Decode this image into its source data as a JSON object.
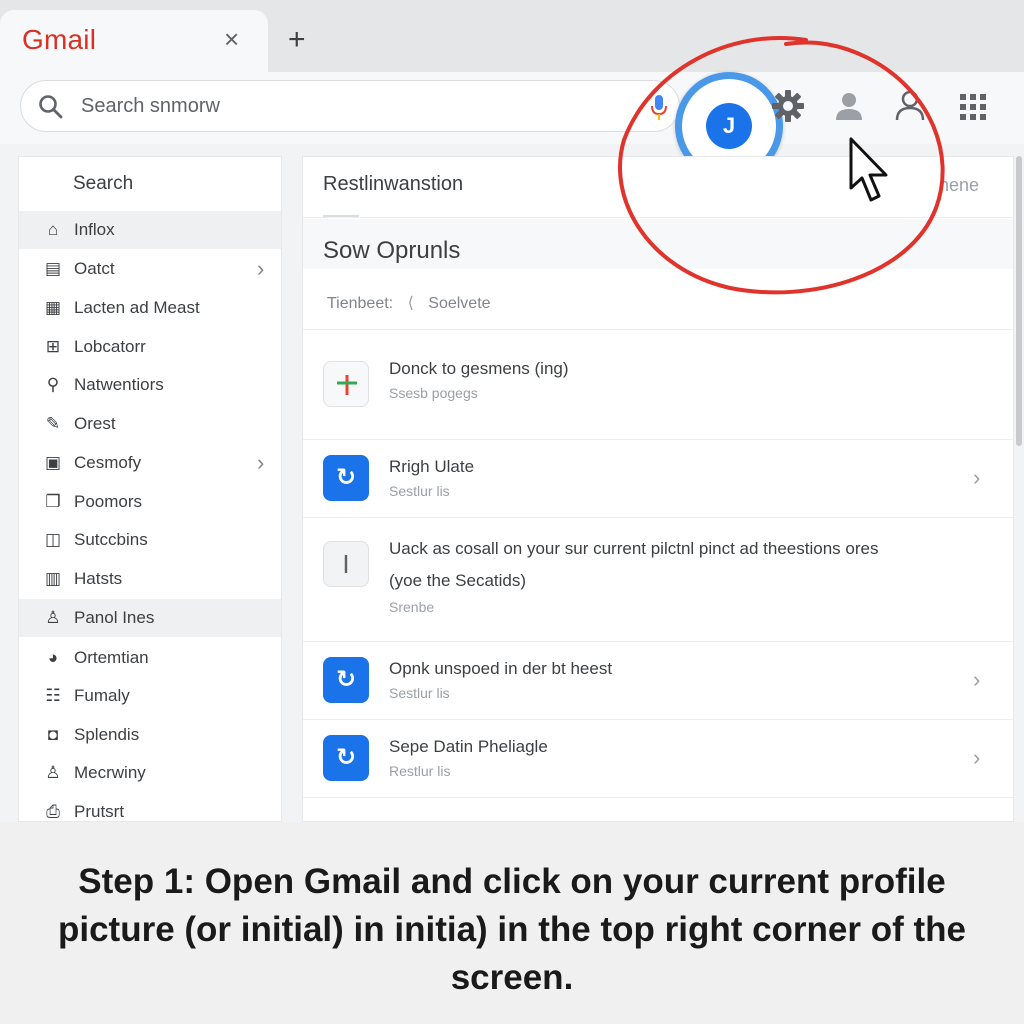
{
  "browser": {
    "tab_title": "Gmail",
    "tab_close": "×",
    "new_tab": "+"
  },
  "header": {
    "search_text": "Search snmorw",
    "avatar_initial": "J",
    "icons": [
      "search-icon",
      "mic-icon",
      "gear-icon",
      "person-icon",
      "person-icon",
      "apps-grid-icon"
    ],
    "accent_ring_color": "#4a98e8",
    "avatar_color": "#1a73e8"
  },
  "sidebar": {
    "heading": "Search",
    "items": [
      {
        "label": "Inflox",
        "icon": "home-icon",
        "chevron": false,
        "active": true
      },
      {
        "label": "Oatct",
        "icon": "contact-card-icon",
        "chevron": true,
        "active": false
      },
      {
        "label": "Lacten ad Meast",
        "icon": "grid-doc-icon",
        "chevron": false,
        "active": false
      },
      {
        "label": "Lobcatorr",
        "icon": "apps-icon",
        "chevron": false,
        "active": false
      },
      {
        "label": "Natwentiors",
        "icon": "location-icon",
        "chevron": false,
        "active": false
      },
      {
        "label": "Orest",
        "icon": "pencil-icon",
        "chevron": false,
        "active": false
      },
      {
        "label": "Cesmofy",
        "icon": "card-icon",
        "chevron": true,
        "active": false
      },
      {
        "label": "Poomors",
        "icon": "copy-icon",
        "chevron": false,
        "active": false
      },
      {
        "label": "Sutccbins",
        "icon": "layers-icon",
        "chevron": false,
        "active": false
      },
      {
        "label": "Hatsts",
        "icon": "calendar-icon",
        "chevron": false,
        "active": false
      },
      {
        "label": "Panol Ines",
        "icon": "person-icon",
        "chevron": false,
        "active": true
      },
      {
        "label": "Ortemtian",
        "icon": "pie-icon",
        "chevron": false,
        "active": false
      },
      {
        "label": "Fumaly",
        "icon": "sliders-icon",
        "chevron": false,
        "active": false
      },
      {
        "label": "Splendis",
        "icon": "chat-icon",
        "chevron": false,
        "active": false
      },
      {
        "label": "Mecrwiny",
        "icon": "person-outline-icon",
        "chevron": false,
        "active": false
      },
      {
        "label": "Prutsrt",
        "icon": "print-icon",
        "chevron": false,
        "active": false
      }
    ]
  },
  "main": {
    "title": "Restlinwanstion",
    "title_right": "nene",
    "section_title": "Sow Oprunls",
    "filter_label": "Tienbeet:",
    "filter_sep": "⟨",
    "filter_value": "Soelvete",
    "items": [
      {
        "title": "Donck to gesmens (ing)",
        "subtitle": "Ssesb pogegs",
        "icon": "plus-color-icon",
        "chevron": false
      },
      {
        "title": "Rrigh Ulate",
        "subtitle": "Sestlur lis",
        "icon": "sync-icon",
        "chevron": true
      },
      {
        "title": "Uack as cosall on your sur current pilctnl pinct ad theestions ores",
        "title2": "(yoe the Secatids)",
        "subtitle": "Srenbe",
        "icon": "text-cursor-icon",
        "chevron": false
      },
      {
        "title": "Opnk unspoed in der bt heest",
        "subtitle": "Sestlur lis",
        "icon": "sync-icon",
        "chevron": true
      },
      {
        "title": "Sepe Datin Pheliagle",
        "subtitle": "Restlur lis",
        "icon": "sync-icon",
        "chevron": true
      }
    ]
  },
  "annotation": {
    "circle_color": "#e0332b",
    "pointer": "mouse-pointer-icon"
  },
  "caption": {
    "line1": "Step 1: Open Gmail and click on your current profile",
    "line2": "picture (or initial) in initia) in the top right corner of the",
    "line3": "screen."
  }
}
